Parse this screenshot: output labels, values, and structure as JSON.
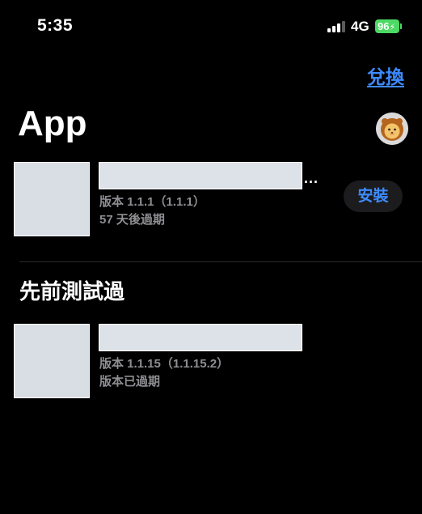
{
  "status_bar": {
    "time": "5:35",
    "network": "4G",
    "battery": "96",
    "battery_icon": "battery-charging-icon",
    "signal_icon": "cellular-signal-icon"
  },
  "header": {
    "redeem_label": "兌換",
    "title": "App",
    "avatar_icon": "lion-avatar-icon"
  },
  "apps": [
    {
      "version": "版本 1.1.1（1.1.1）",
      "status": "57 天後過期",
      "truncation": "...",
      "action_label": "安裝"
    }
  ],
  "previous_section": {
    "title": "先前測試過",
    "apps": [
      {
        "version": "版本 1.1.15（1.1.15.2）",
        "status": "版本已過期"
      }
    ]
  },
  "colors": {
    "background": "#000000",
    "accent": "#3d8bff",
    "secondary_text": "#8e8e93",
    "battery": "#4cd964",
    "placeholder": "#dde1e8"
  }
}
